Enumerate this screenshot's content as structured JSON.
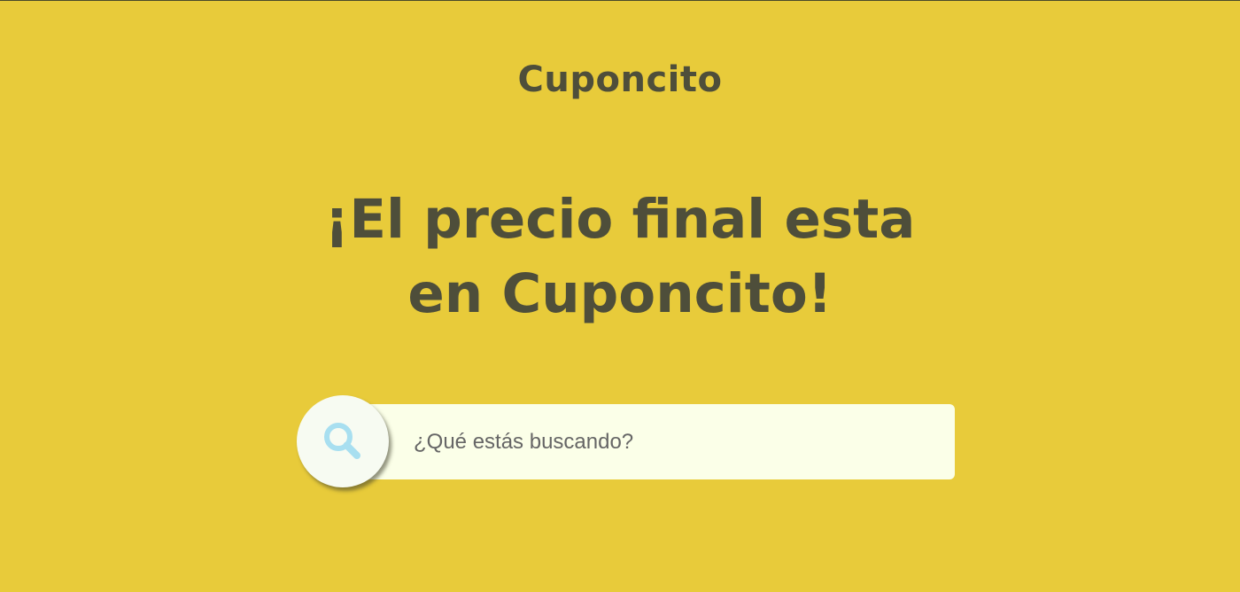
{
  "header": {
    "brand": "Cuponcito"
  },
  "hero": {
    "headline_line1": "¡El precio final esta",
    "headline_line2": "en Cuponcito!"
  },
  "search": {
    "placeholder": "¿Qué estás buscando?",
    "value": "",
    "icon": "search-icon"
  },
  "colors": {
    "background": "#e8cb3a",
    "text": "#4e4e3a",
    "search_field": "#fbffe8",
    "search_icon": "#a8dff0"
  }
}
